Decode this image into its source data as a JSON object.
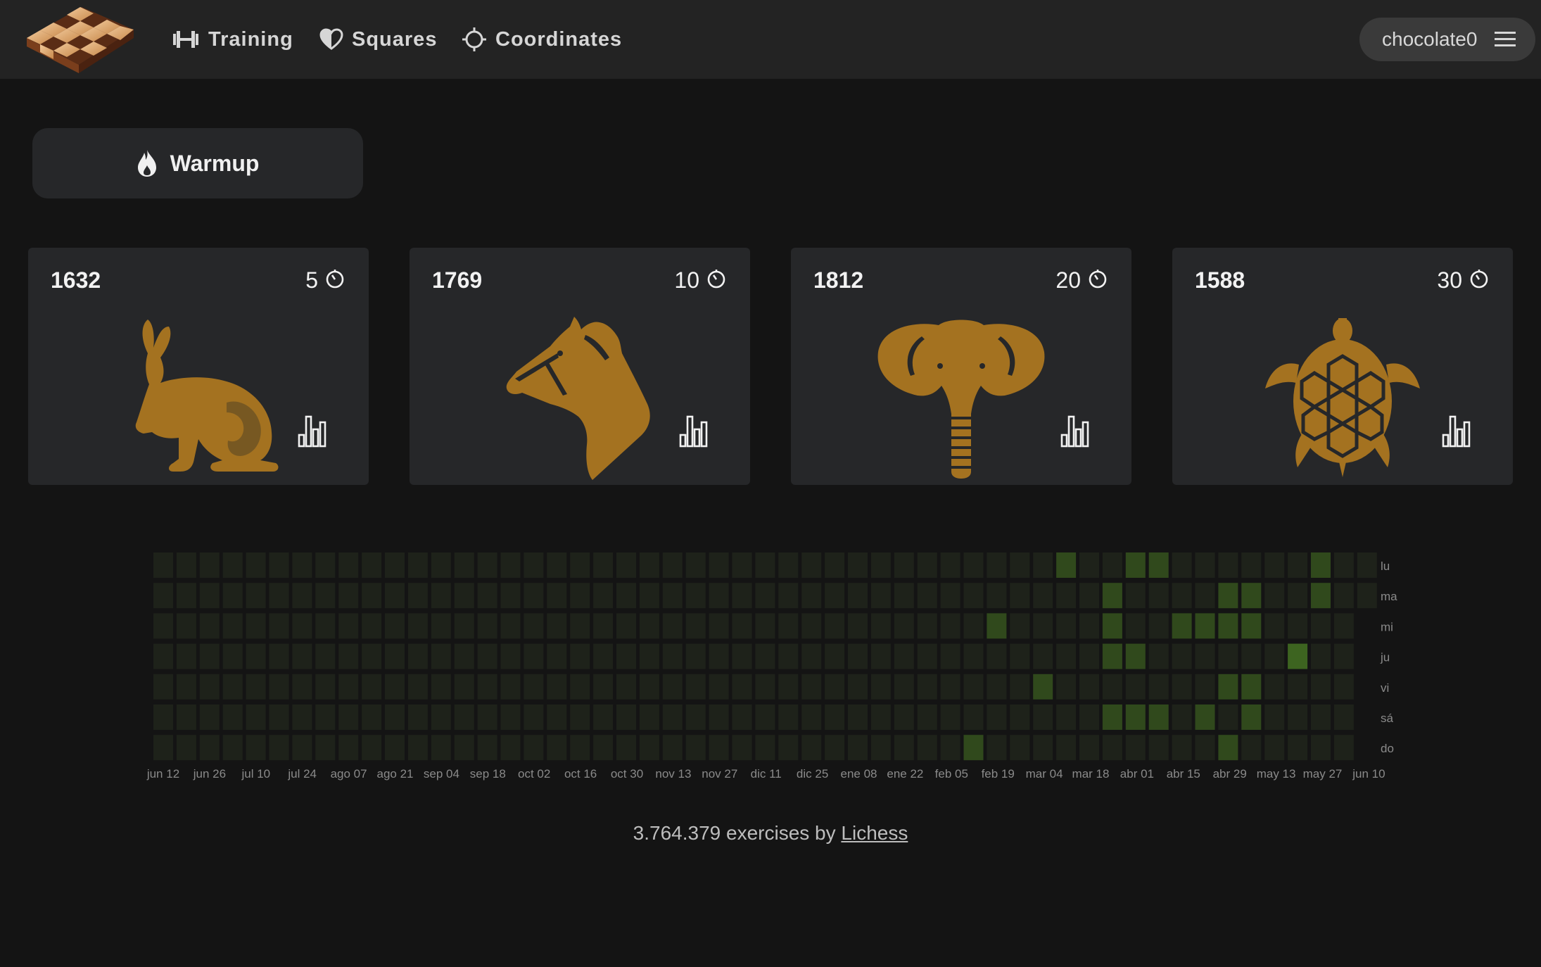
{
  "nav": {
    "items": [
      {
        "label": "Training",
        "icon": "dumbbell-icon"
      },
      {
        "label": "Squares",
        "icon": "heart-icon"
      },
      {
        "label": "Coordinates",
        "icon": "crosshair-icon"
      }
    ],
    "user": "chocolate0"
  },
  "warmup": {
    "label": "Warmup",
    "icon": "flame-icon"
  },
  "modes": [
    {
      "rating": "1632",
      "minutes": "5",
      "animal": "rabbit-icon"
    },
    {
      "rating": "1769",
      "minutes": "10",
      "animal": "horse-icon"
    },
    {
      "rating": "1812",
      "minutes": "20",
      "animal": "elephant-icon"
    },
    {
      "rating": "1588",
      "minutes": "30",
      "animal": "turtle-icon"
    }
  ],
  "heatmap": {
    "day_labels": [
      "lu",
      "ma",
      "mi",
      "ju",
      "vi",
      "sá",
      "do"
    ],
    "month_labels": [
      "jun 12",
      "jun 26",
      "jul 10",
      "jul 24",
      "ago 07",
      "ago 21",
      "sep 04",
      "sep 18",
      "oct 02",
      "oct 16",
      "oct 30",
      "nov 13",
      "nov 27",
      "dic 11",
      "dic 25",
      "ene 08",
      "ene 22",
      "feb 05",
      "feb 19",
      "mar 04",
      "mar 18",
      "abr 01",
      "abr 15",
      "abr 29",
      "may 13",
      "may 27",
      "jun 10"
    ],
    "weeks": 53,
    "active": [
      {
        "week": 39,
        "day": 0,
        "level": 2
      },
      {
        "week": 42,
        "day": 0,
        "level": 2
      },
      {
        "week": 43,
        "day": 0,
        "level": 2
      },
      {
        "week": 50,
        "day": 0,
        "level": 2
      },
      {
        "week": 41,
        "day": 1,
        "level": 2
      },
      {
        "week": 46,
        "day": 1,
        "level": 2
      },
      {
        "week": 47,
        "day": 1,
        "level": 2
      },
      {
        "week": 50,
        "day": 1,
        "level": 2
      },
      {
        "week": 36,
        "day": 2,
        "level": 2
      },
      {
        "week": 41,
        "day": 2,
        "level": 2
      },
      {
        "week": 44,
        "day": 2,
        "level": 2
      },
      {
        "week": 45,
        "day": 2,
        "level": 2
      },
      {
        "week": 46,
        "day": 2,
        "level": 2
      },
      {
        "week": 47,
        "day": 2,
        "level": 2
      },
      {
        "week": 41,
        "day": 3,
        "level": 2
      },
      {
        "week": 42,
        "day": 3,
        "level": 2
      },
      {
        "week": 49,
        "day": 3,
        "level": 3
      },
      {
        "week": 38,
        "day": 4,
        "level": 2
      },
      {
        "week": 46,
        "day": 4,
        "level": 2
      },
      {
        "week": 47,
        "day": 4,
        "level": 2
      },
      {
        "week": 41,
        "day": 5,
        "level": 2
      },
      {
        "week": 42,
        "day": 5,
        "level": 2
      },
      {
        "week": 43,
        "day": 5,
        "level": 2
      },
      {
        "week": 45,
        "day": 5,
        "level": 2
      },
      {
        "week": 47,
        "day": 5,
        "level": 2
      },
      {
        "week": 35,
        "day": 6,
        "level": 2
      },
      {
        "week": 46,
        "day": 6,
        "level": 2
      }
    ],
    "colors": {
      "empty": "#1e221a",
      "level1": "#273a1a",
      "level2": "#30491c",
      "level3": "#3d6420"
    }
  },
  "footer": {
    "count_text": "3.764.379 exercises by",
    "link": "Lichess"
  },
  "colors": {
    "animal": "#a47220",
    "background": "#141414",
    "card": "#262729"
  }
}
